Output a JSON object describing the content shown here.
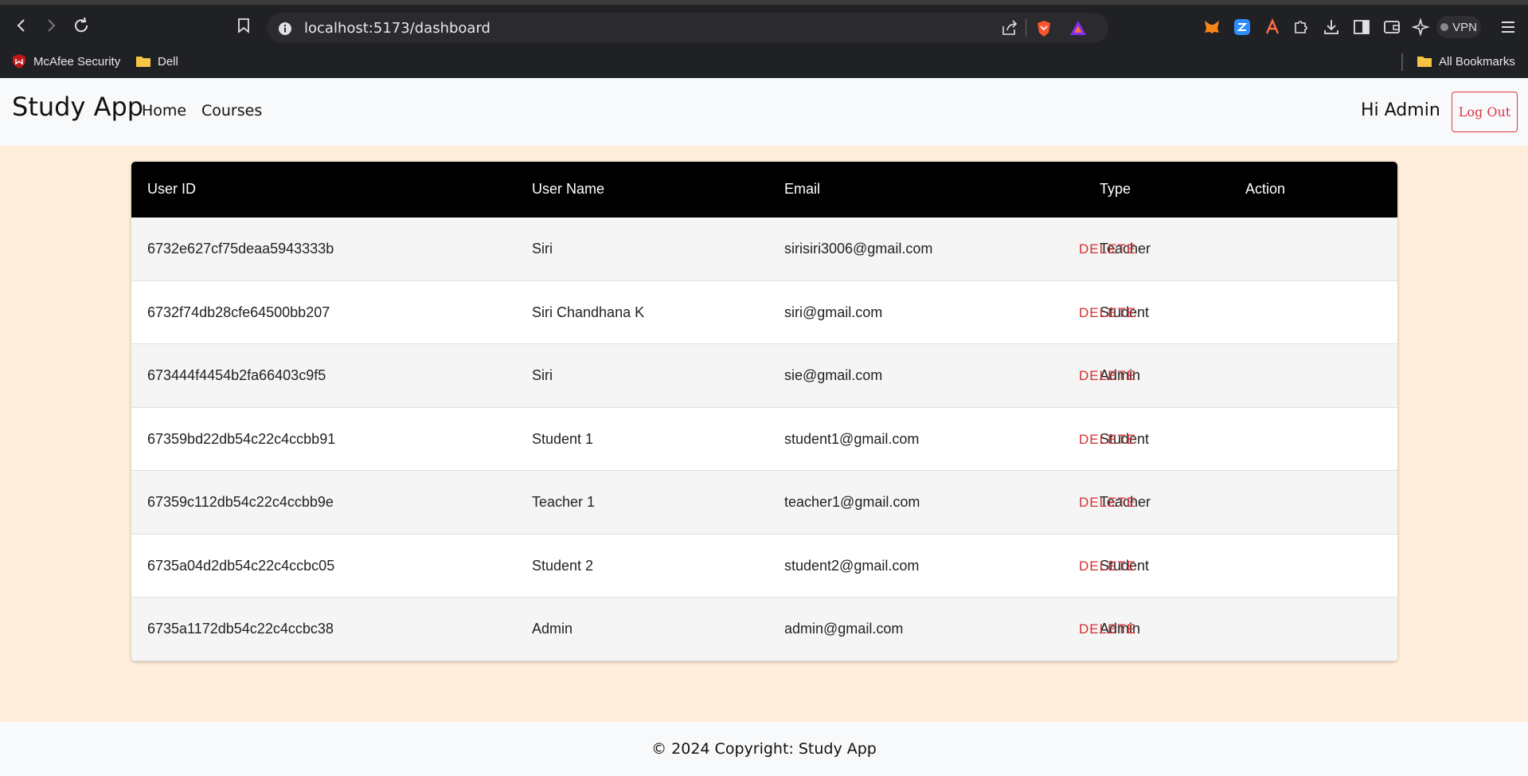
{
  "browser": {
    "url": "localhost:5173/dashboard",
    "bookmarks": [
      {
        "label": "McAfee Security",
        "icon": "mcafee-icon"
      },
      {
        "label": "Dell",
        "icon": "folder-icon"
      }
    ],
    "all_bookmarks_label": "All Bookmarks",
    "vpn_label": "VPN"
  },
  "navbar": {
    "brand": "Study App",
    "links": [
      "Home",
      "Courses"
    ],
    "greeting": "Hi Admin",
    "logout_label": "Log Out"
  },
  "table": {
    "headers": [
      "User ID",
      "User Name",
      "Email",
      "Type",
      "Action"
    ],
    "rows": [
      {
        "id": "6732e627cf75deaa5943333b",
        "name": "Siri",
        "email": "sirisiri3006@gmail.com",
        "type": "Teacher",
        "action": "DELETE"
      },
      {
        "id": "6732f74db28cfe64500bb207",
        "name": "Siri Chandhana K",
        "email": "siri@gmail.com",
        "type": "Student",
        "action": "DELETE"
      },
      {
        "id": "673444f4454b2fa66403c9f5",
        "name": "Siri",
        "email": "sie@gmail.com",
        "type": "Admin",
        "action": "DELETE"
      },
      {
        "id": "67359bd22db54c22c4ccbb91",
        "name": "Student 1",
        "email": "student1@gmail.com",
        "type": "Student",
        "action": "DELETE"
      },
      {
        "id": "67359c112db54c22c4ccbb9e",
        "name": "Teacher 1",
        "email": "teacher1@gmail.com",
        "type": "Teacher",
        "action": "DELETE"
      },
      {
        "id": "6735a04d2db54c22c4ccbc05",
        "name": "Student 2",
        "email": "student2@gmail.com",
        "type": "Student",
        "action": "DELETE"
      },
      {
        "id": "6735a1172db54c22c4ccbc38",
        "name": "Admin",
        "email": "admin@gmail.com",
        "type": "Admin",
        "action": "DELETE"
      }
    ]
  },
  "footer": {
    "text": "© 2024 Copyright: Study App"
  },
  "colors": {
    "page_bg": "#ffeedb",
    "header_bg": "#000000",
    "delete": "#d32f2f",
    "logout": "#dc3545"
  }
}
